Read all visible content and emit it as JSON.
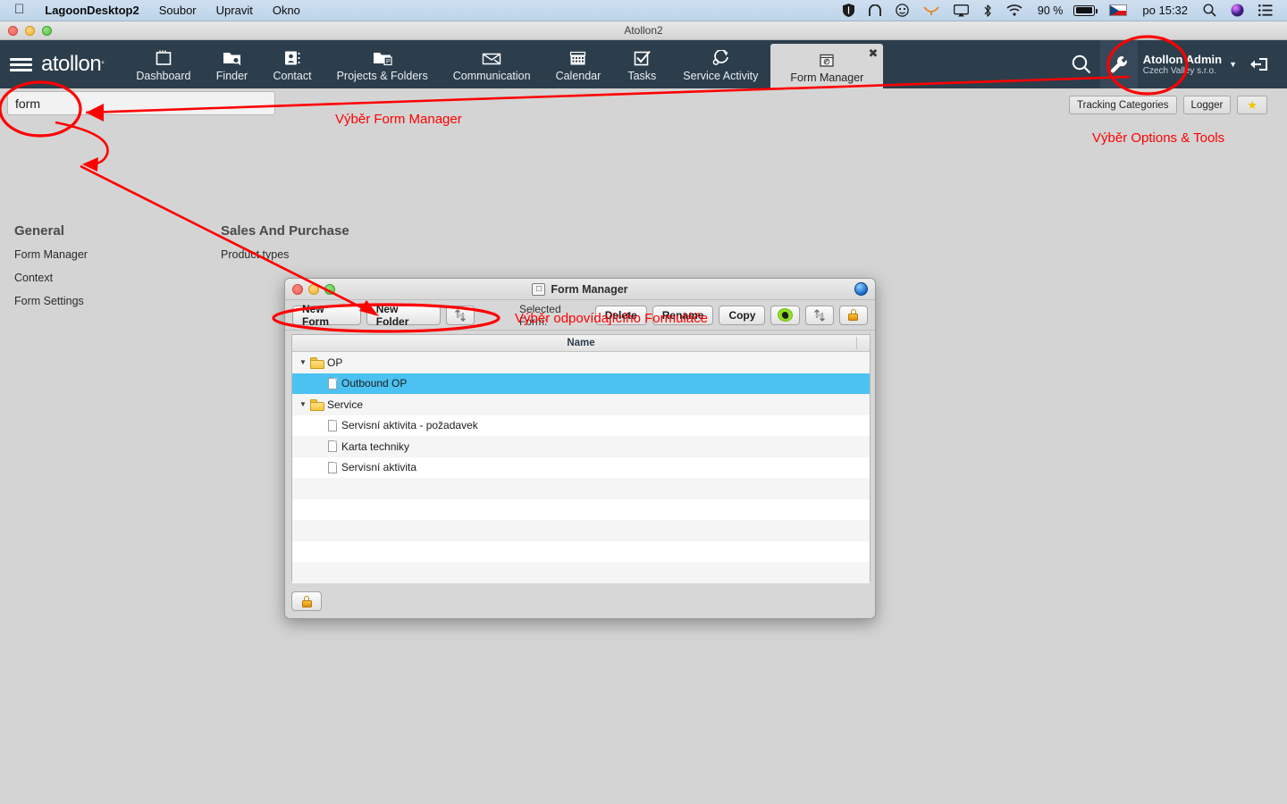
{
  "macos_menubar": {
    "apple_icon": "apple-icon",
    "app_name": "LagoonDesktop2",
    "menus": [
      "Soubor",
      "Upravit",
      "Okno"
    ],
    "status_icons": [
      "shield-icon",
      "arc-icon",
      "smiley-icon",
      "orange-curve-icon",
      "airplay-icon",
      "bluetooth-icon",
      "wifi-icon"
    ],
    "battery_percent": "90 %",
    "keyboard_flag": "czech-flag-icon",
    "clock": "po 15:32",
    "right_icons": [
      "search-icon",
      "siri-icon",
      "notification-center-icon"
    ]
  },
  "window": {
    "title": "Atollon2"
  },
  "navbar": {
    "brand": "atollon",
    "brand_mark": "°",
    "tabs": [
      {
        "label": "Dashboard",
        "icon": "dashboard-icon",
        "active": false
      },
      {
        "label": "Finder",
        "icon": "finder-folder-icon",
        "active": false
      },
      {
        "label": "Contact",
        "icon": "contact-card-icon",
        "active": false
      },
      {
        "label": "Projects & Folders",
        "icon": "projects-folder-icon",
        "active": false
      },
      {
        "label": "Communication",
        "icon": "envelope-icon",
        "active": false
      },
      {
        "label": "Calendar",
        "icon": "calendar-icon",
        "active": false
      },
      {
        "label": "Tasks",
        "icon": "checkbox-icon",
        "active": false
      },
      {
        "label": "Service Activity",
        "icon": "service-gear-icon",
        "active": false
      },
      {
        "label": "Form Manager",
        "icon": "form-window-icon",
        "active": true
      }
    ],
    "tab_close_label": "✖",
    "search_icon": "search-icon",
    "tools_icon": "wrench-icon",
    "user_name": "Atollon Admin",
    "user_org": "Czech Valley s.r.o.",
    "user_caret": "▼",
    "logout_icon": "logout-icon"
  },
  "page": {
    "search": {
      "value": "form",
      "placeholder": ""
    },
    "columns": [
      {
        "heading": "General",
        "items": [
          "Form Manager",
          "Context",
          "Form Settings"
        ]
      },
      {
        "heading": "Sales And Purchase",
        "items": [
          "Product types"
        ]
      }
    ],
    "toolbar_right": [
      {
        "label": "Tracking Categories",
        "name": "tracking-categories-button"
      },
      {
        "label": "Logger",
        "name": "logger-button"
      },
      {
        "label": "★",
        "name": "favorite-star-button"
      }
    ]
  },
  "form_manager_dialog": {
    "title": "Form Manager",
    "title_icon": "form-window-icon",
    "orb_icon": "blue-orb-icon",
    "toolbar": {
      "new_form": "New Form",
      "new_folder": "New Folder",
      "transfer_icon": "import-export-icon",
      "selected_form_label": "Selected Form:",
      "delete": "Delete",
      "rename": "Rename",
      "copy": "Copy",
      "preview_icon": "green-highlight-icon",
      "sync_icon": "import-export-icon",
      "lock_icon": "lock-icon"
    },
    "list_header": "Name",
    "rows": [
      {
        "type": "folder",
        "label": "OP",
        "expanded": true,
        "selected": false
      },
      {
        "type": "file",
        "label": "Outbound OP",
        "selected": true
      },
      {
        "type": "folder",
        "label": "Service",
        "expanded": true,
        "selected": false
      },
      {
        "type": "file",
        "label": "Servisní aktivita - požadavek",
        "selected": false
      },
      {
        "type": "file",
        "label": "Karta techniky",
        "selected": false
      },
      {
        "type": "file",
        "label": "Servisní aktivita",
        "selected": false
      },
      {
        "type": "empty",
        "label": "",
        "selected": false
      },
      {
        "type": "empty",
        "label": "",
        "selected": false
      },
      {
        "type": "empty",
        "label": "",
        "selected": false
      },
      {
        "type": "empty",
        "label": "",
        "selected": false
      },
      {
        "type": "empty",
        "label": "",
        "selected": false
      }
    ],
    "footer_lock_icon": "lock-icon"
  },
  "annotations": {
    "color": "#ff0000",
    "texts": [
      {
        "text": "Výběr Form Manager",
        "name": "annotation-select-form-manager"
      },
      {
        "text": "Výběr Options & Tools",
        "name": "annotation-select-options-tools"
      },
      {
        "text": "Výběr odpovídajícího Formuláče",
        "name": "annotation-select-matching-form"
      }
    ]
  }
}
